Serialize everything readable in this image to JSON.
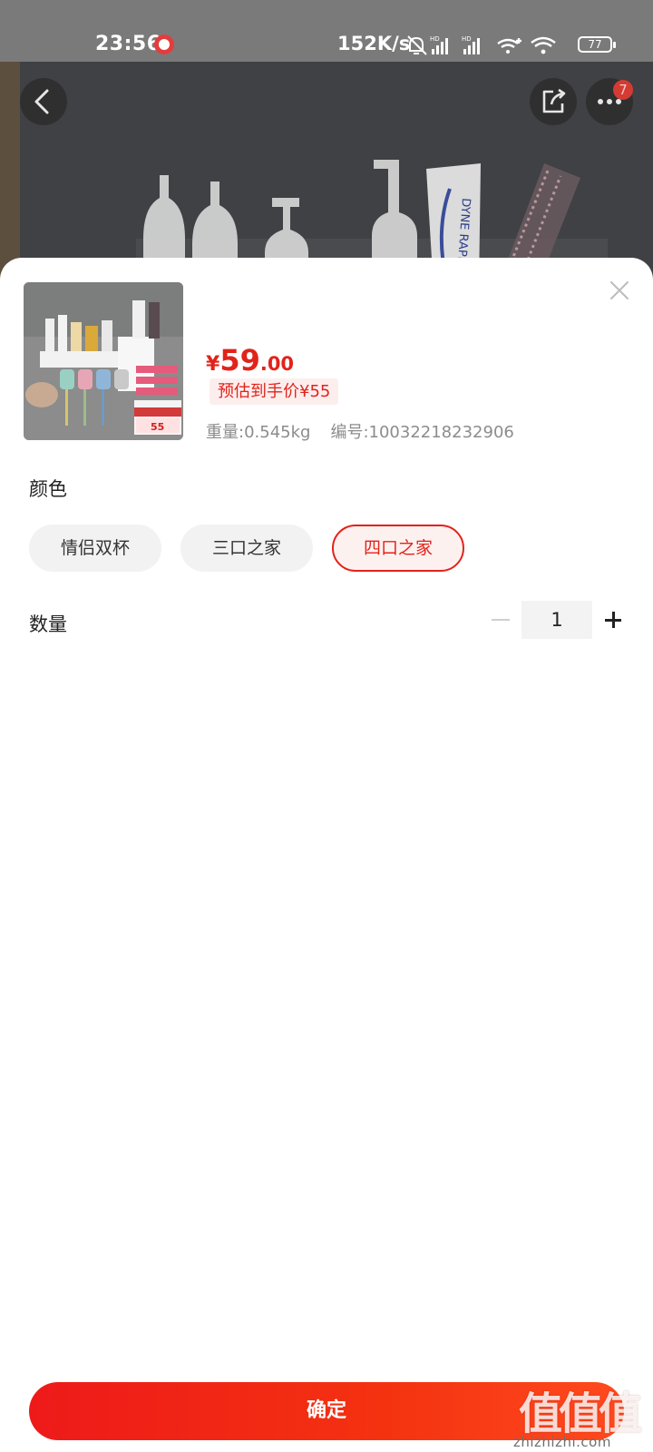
{
  "status_bar": {
    "time": "23:56",
    "net_speed": "152K/s",
    "battery": "77",
    "icons": [
      "app-notification-icon",
      "mute-icon",
      "hd-signal-icon",
      "hd-signal-icon",
      "signal-plus-icon",
      "wifi-icon",
      "battery-icon"
    ]
  },
  "header": {
    "more_badge": "7"
  },
  "product": {
    "price_symbol": "¥",
    "price_int": "59",
    "price_dec": ".00",
    "estimated_price": "预估到手价¥55",
    "weight": "重量:0.545kg",
    "sku": "编号:10032218232906"
  },
  "color_section": {
    "title": "颜色",
    "options": [
      {
        "label": "情侣双杯",
        "selected": false
      },
      {
        "label": "三口之家",
        "selected": false
      },
      {
        "label": "四口之家",
        "selected": true
      }
    ]
  },
  "quantity_section": {
    "title": "数量",
    "value": "1"
  },
  "confirm_label": "确定",
  "watermark": {
    "logo": "值值值",
    "url": "zhizhizhi.com"
  },
  "colors": {
    "accent": "#e2231a",
    "accent_bg": "#fdeeee",
    "status_bar": "#7a7a7a",
    "chip_bg": "#f2f2f2"
  }
}
